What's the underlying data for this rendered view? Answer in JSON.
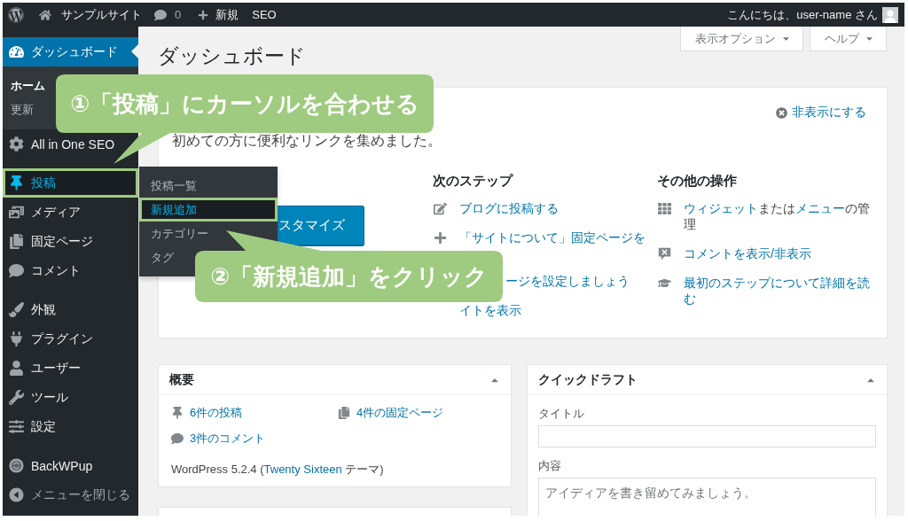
{
  "admin_bar": {
    "site_name": "サンプルサイト",
    "comments_count": "0",
    "new_label": "新規",
    "seo_label": "SEO",
    "greeting": "こんにちは、user-name さん"
  },
  "sidebar": {
    "groups": [
      [
        {
          "label": "ダッシュボード",
          "selected": true,
          "hovered": false,
          "highlighted": false,
          "children": [
            {
              "label": "ホーム",
              "selected": true
            },
            {
              "label": "更新",
              "selected": false
            }
          ]
        },
        {
          "label": "All in One SEO",
          "selected": false,
          "hovered": false,
          "highlighted": false
        }
      ],
      [
        {
          "label": "投稿",
          "selected": false,
          "hovered": true,
          "highlighted": true,
          "children": [
            {
              "label": "投稿一覧",
              "hovered": false,
              "highlighted": false
            },
            {
              "label": "新規追加",
              "hovered": true,
              "highlighted": true
            },
            {
              "label": "カテゴリー",
              "hovered": false,
              "highlighted": false
            },
            {
              "label": "タグ",
              "hovered": false,
              "highlighted": false
            }
          ]
        },
        {
          "label": "メディア",
          "selected": false,
          "hovered": false,
          "highlighted": false
        },
        {
          "label": "固定ページ",
          "selected": false,
          "hovered": false,
          "highlighted": false
        },
        {
          "label": "コメント",
          "selected": false,
          "hovered": false,
          "highlighted": false
        }
      ],
      [
        {
          "label": "外観",
          "selected": false,
          "hovered": false,
          "highlighted": false
        },
        {
          "label": "プラグイン",
          "selected": false,
          "hovered": false,
          "highlighted": false
        },
        {
          "label": "ユーザー",
          "selected": false,
          "hovered": false,
          "highlighted": false
        },
        {
          "label": "ツール",
          "selected": false,
          "hovered": false,
          "highlighted": false
        },
        {
          "label": "設定",
          "selected": false,
          "hovered": false,
          "highlighted": false
        }
      ],
      [
        {
          "label": "BackWPup",
          "selected": false,
          "hovered": false,
          "highlighted": false
        }
      ]
    ],
    "collapse_label": "メニューを閉じる"
  },
  "screen_options": [
    {
      "label": "表示オプション",
      "expanded": false
    },
    {
      "label": "ヘルプ",
      "expanded": false
    }
  ],
  "page_title": "ダッシュボード",
  "welcome_panel": {
    "dismiss_label": "非表示にする",
    "intro": "初めての方に便利なリンクを集めました。",
    "customize_button": "スタマイズ",
    "columns": [
      {
        "heading": "次のステップ",
        "items": [
          {
            "segments": [
              {
                "kind": "link",
                "text": "ブログに投稿する"
              }
            ]
          },
          {
            "segments": [
              {
                "kind": "link",
                "text": "「サイトについて」固定ページを"
              }
            ]
          },
          {
            "segments": [
              {
                "kind": "link",
                "text": "ージを設定しましょう"
              }
            ]
          },
          {
            "segments": [
              {
                "kind": "link",
                "text": "イトを表示"
              }
            ]
          }
        ]
      },
      {
        "heading": "その他の操作",
        "items": [
          {
            "segments": [
              {
                "kind": "link",
                "text": "ウィジェット"
              },
              {
                "kind": "text",
                "text": "または"
              },
              {
                "kind": "link",
                "text": "メニュー"
              },
              {
                "kind": "text",
                "text": "の管理"
              }
            ]
          },
          {
            "segments": [
              {
                "kind": "link",
                "text": "コメントを表示/非表示"
              }
            ]
          },
          {
            "segments": [
              {
                "kind": "link",
                "text": "最初のステップについて詳細を読む"
              }
            ]
          }
        ]
      }
    ]
  },
  "at_a_glance": {
    "title": "概要",
    "expanded": true,
    "items": [
      "6件の投稿",
      "4件の固定ページ",
      "3件のコメント"
    ],
    "version": [
      {
        "kind": "text",
        "text": "WordPress 5.2.4 ("
      },
      {
        "kind": "link",
        "text": "Twenty Sixteen"
      },
      {
        "kind": "text",
        "text": " テーマ)"
      }
    ]
  },
  "quick_draft": {
    "title": "クイックドラフト",
    "expanded": true,
    "title_field": {
      "label": "タイトル"
    },
    "content_field": {
      "label": "内容",
      "placeholder": "アイディアを書き留めてみましょう。"
    }
  },
  "callouts": [
    {
      "text": "①「投稿」にカーソルを合わせる"
    },
    {
      "text": "②「新規追加」をクリック"
    }
  ]
}
